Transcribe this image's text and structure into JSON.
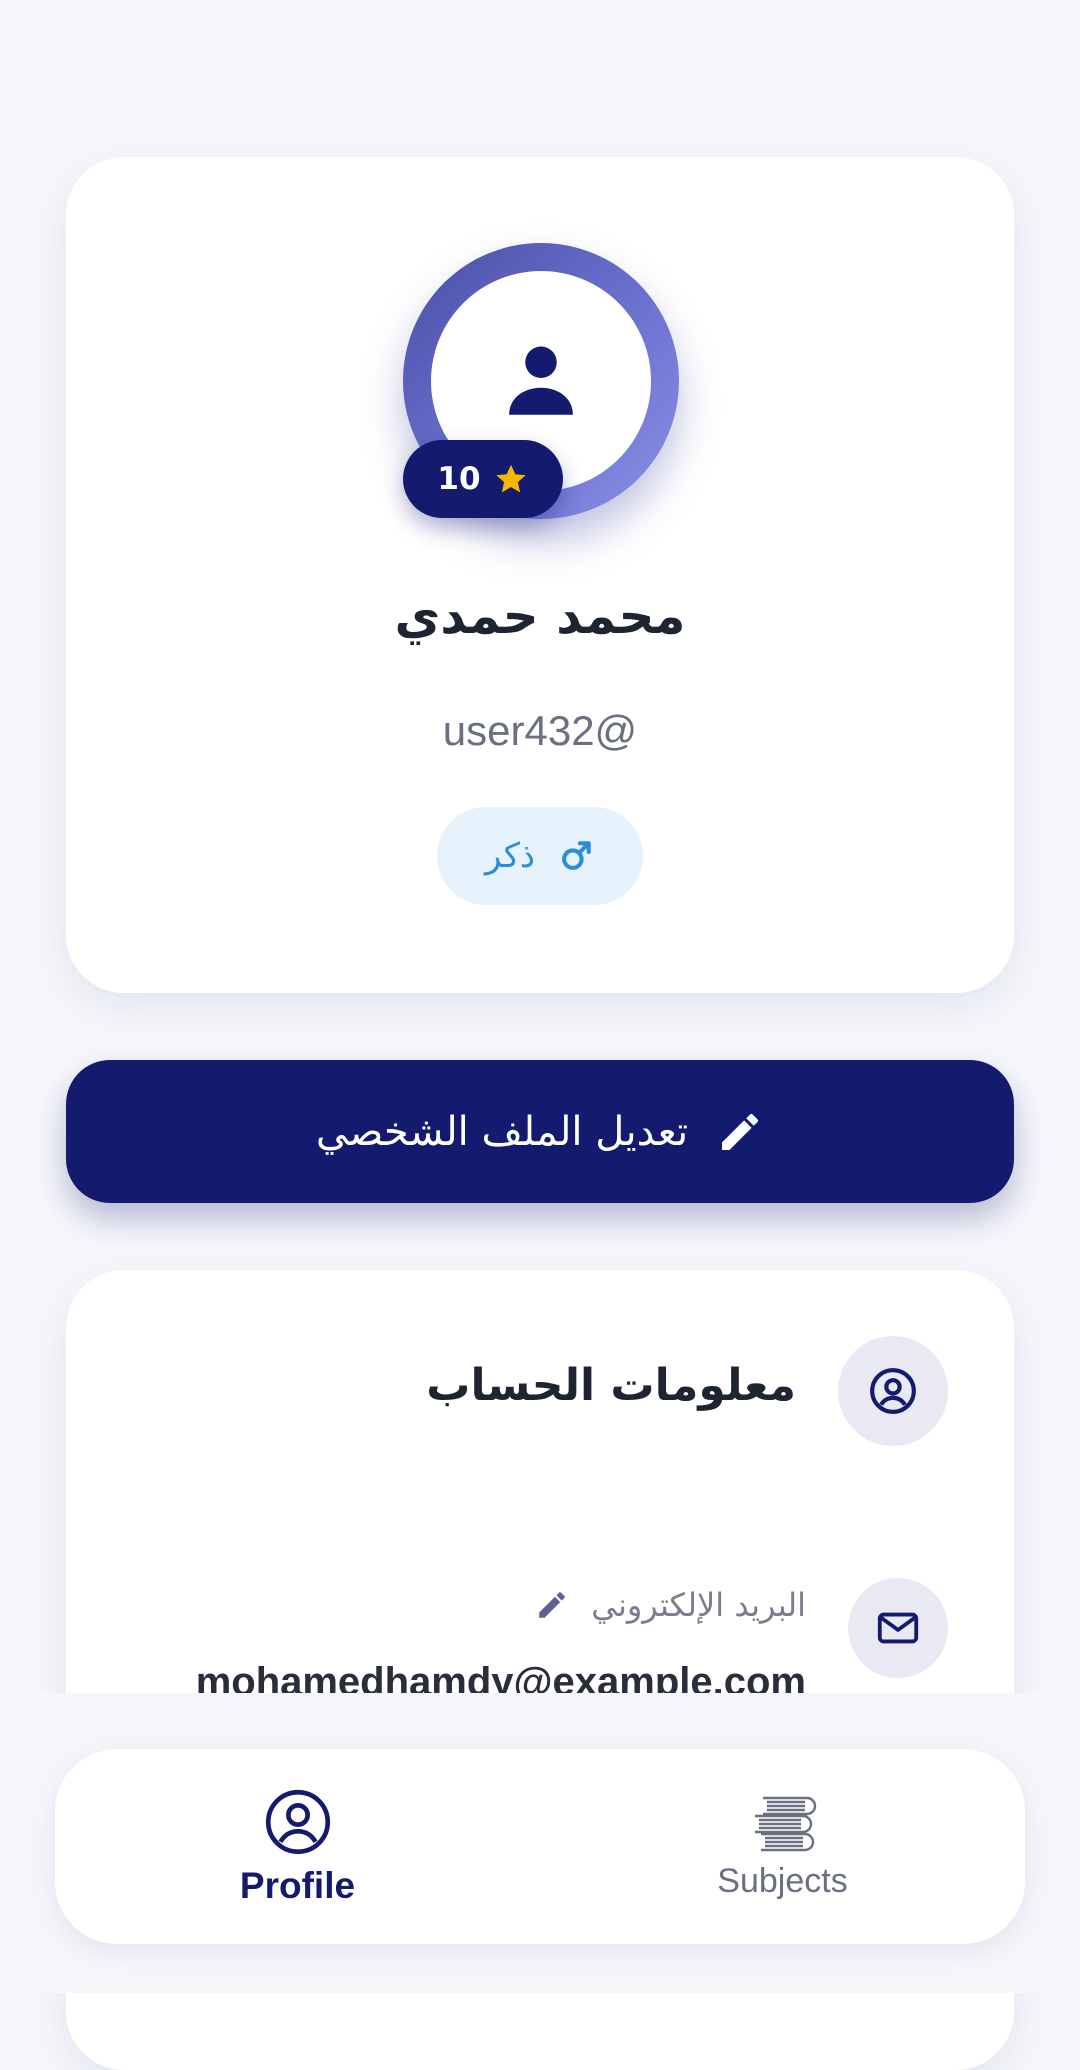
{
  "profile": {
    "level": "10",
    "name": "محمد حمدي",
    "handle": "user432@",
    "gender": "ذكر"
  },
  "actions": {
    "edit_profile": "تعديل الملف الشخصي"
  },
  "account_info": {
    "title": "معلومات الحساب",
    "email_label": "البريد الإلكتروني",
    "email_value": "mohamedhamdy@example.com"
  },
  "bottom_nav": {
    "items": [
      {
        "label": "Profile",
        "icon": "person-circle-icon",
        "active": true
      },
      {
        "label": "Subjects",
        "icon": "books-icon",
        "active": false
      }
    ]
  },
  "colors": {
    "primary": "#141a6e",
    "accent_star": "#f5b800",
    "gender_chip_bg": "#e6f3fd",
    "gender_chip_text": "#2a8fd6",
    "background": "#f6f7fb"
  }
}
